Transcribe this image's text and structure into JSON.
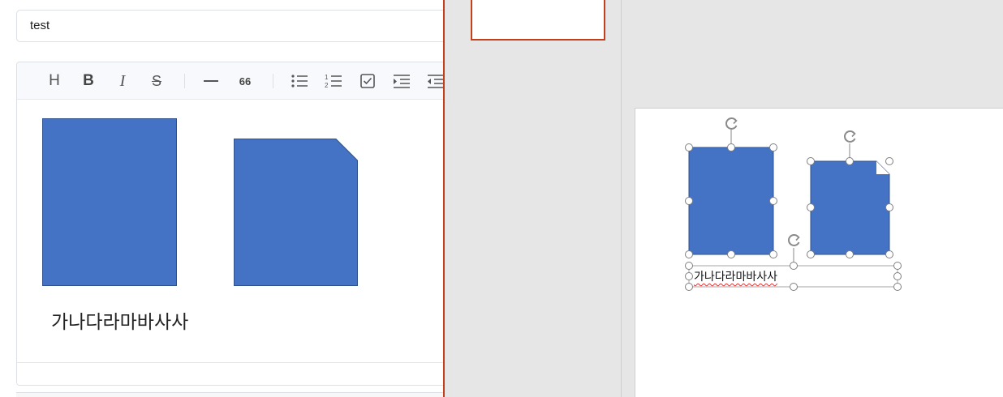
{
  "editor": {
    "title_value": "test",
    "toolbar": {
      "heading": "H",
      "bold": "B",
      "italic": "I",
      "strike": "S",
      "quote": "66"
    },
    "body_text": "가나다라마바사사"
  },
  "slide": {
    "textbox_text": "가나다라마바사사"
  },
  "colors": {
    "shape_fill": "#4472c4",
    "shape_border": "#2f528f",
    "accent": "#c43e1c"
  }
}
